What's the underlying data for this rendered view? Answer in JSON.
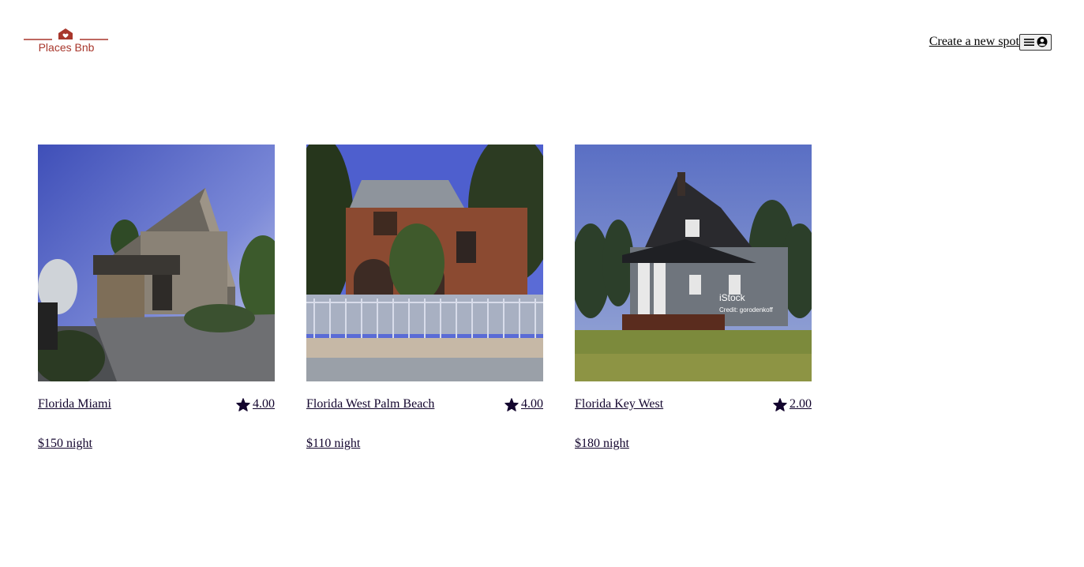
{
  "header": {
    "logo_text": "Places Bnb",
    "create_spot_label": "Create a new spot",
    "menu_icons": [
      "hamburger-icon",
      "user-circle-icon"
    ]
  },
  "colors": {
    "brand_red": "#a8372c",
    "text_dark": "#13052e"
  },
  "spots": [
    {
      "name": "Florida Miami",
      "rating": "4.00",
      "price": "$150 night",
      "image": "modern-gray-gable-house"
    },
    {
      "name": "Florida West Palm Beach",
      "rating": "4.00",
      "price": "$110 night",
      "image": "brick-house-with-fence"
    },
    {
      "name": "Florida Key West",
      "rating": "2.00",
      "price": "$180 night",
      "image": "gray-house-with-deck",
      "image_watermark": [
        "iStock",
        "Credit: gorodenkoff"
      ]
    }
  ]
}
